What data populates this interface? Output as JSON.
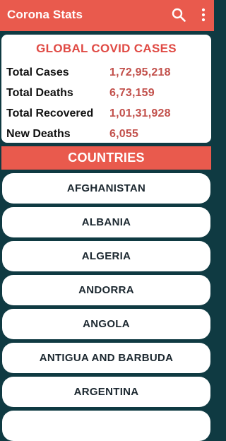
{
  "app": {
    "title": "Corona Stats"
  },
  "icons": {
    "search": "search-icon",
    "more": "more-vert-icon"
  },
  "colors": {
    "accent": "#e95a4d",
    "background": "#0f3a42",
    "value": "#c2504b"
  },
  "global": {
    "heading": "GLOBAL COVID CASES",
    "stats": [
      {
        "label": "Total Cases",
        "value": "1,72,95,218"
      },
      {
        "label": "Total Deaths",
        "value": "6,73,159"
      },
      {
        "label": "Total Recovered",
        "value": "1,01,31,928"
      },
      {
        "label": "New Deaths",
        "value": "6,055"
      }
    ]
  },
  "countries": {
    "heading": "COUNTRIES",
    "items": [
      "AFGHANISTAN",
      "ALBANIA",
      "ALGERIA",
      "ANDORRA",
      "ANGOLA",
      "ANTIGUA AND BARBUDA",
      "ARGENTINA"
    ]
  }
}
